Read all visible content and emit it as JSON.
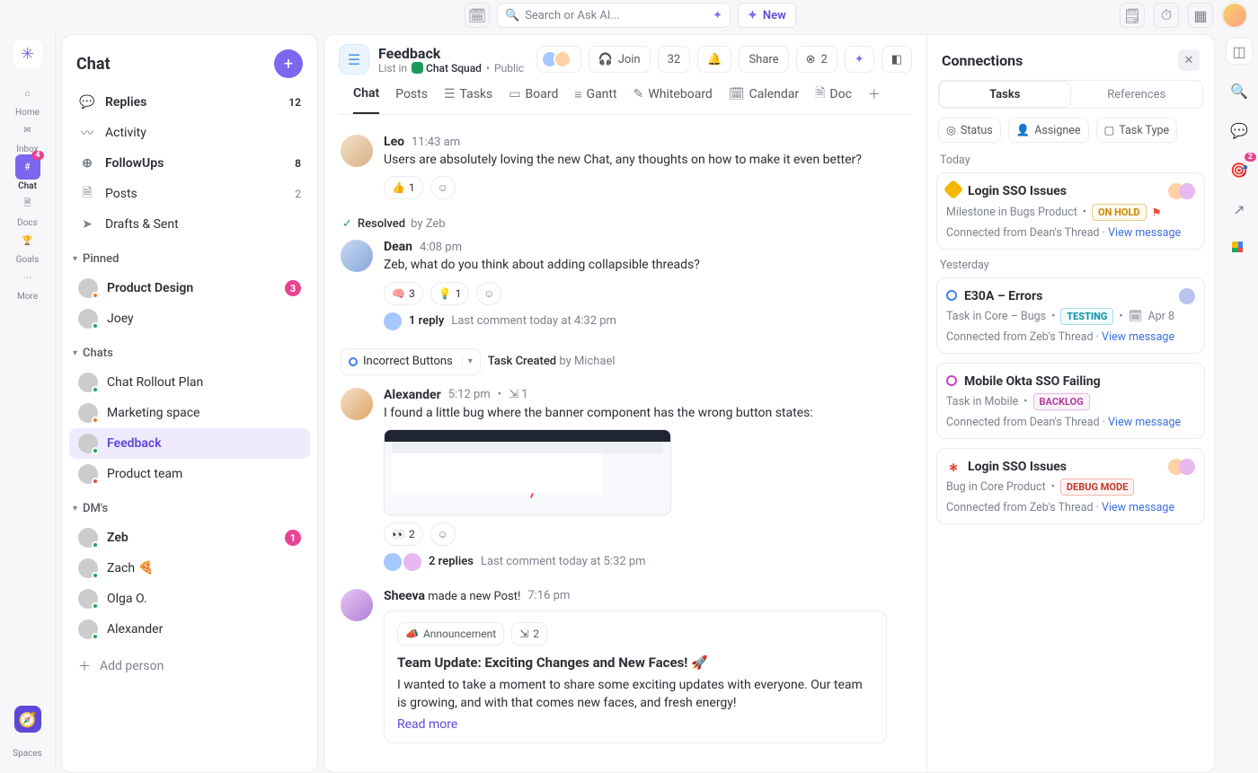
{
  "topbar": {
    "search_placeholder": "Search or Ask AI...",
    "new_label": "New"
  },
  "rail": {
    "items": [
      {
        "label": "Home",
        "glyph": "⌂"
      },
      {
        "label": "Inbox",
        "glyph": "✉"
      },
      {
        "label": "Chat",
        "glyph": "#",
        "badge": "4",
        "active": true
      },
      {
        "label": "Docs",
        "glyph": "🗎"
      },
      {
        "label": "Goals",
        "glyph": "🏆"
      },
      {
        "label": "More",
        "glyph": "⋯"
      }
    ],
    "spaces_label": "Spaces"
  },
  "chat_sidebar": {
    "title": "Chat",
    "top_rows": [
      {
        "icon": "💬",
        "label": "Replies",
        "badge": "12",
        "bold": true
      },
      {
        "icon": "〰",
        "label": "Activity"
      },
      {
        "icon": "⊕",
        "label": "FollowUps",
        "badge": "8",
        "bold": true
      },
      {
        "icon": "🗎",
        "label": "Posts",
        "badge": "2"
      },
      {
        "icon": "➤",
        "label": "Drafts & Sent"
      }
    ],
    "groups": [
      {
        "title": "Pinned",
        "items": [
          {
            "label": "Product Design",
            "badge": "3",
            "bold": true,
            "avatar": "av-g1",
            "dot": "dot-or"
          },
          {
            "label": "Joey",
            "avatar": "av-g3",
            "dot": "dot-gr"
          }
        ]
      },
      {
        "title": "Chats",
        "items": [
          {
            "label": "Chat Rollout Plan",
            "avatar": "av-g2",
            "dot": "dot-gr"
          },
          {
            "label": "Marketing space",
            "avatar": "av-g4",
            "dot": "dot-or"
          },
          {
            "label": "Feedback",
            "active": true,
            "avatar": "av-g1",
            "dot": "dot-gr"
          },
          {
            "label": "Product team",
            "avatar": "av-g5",
            "dot": "dot-rd"
          }
        ]
      },
      {
        "title": "DM's",
        "items": [
          {
            "label": "Zeb",
            "badge": "1",
            "bold": true,
            "avatar": "av-g2",
            "dot": "dot-gr"
          },
          {
            "label": "Zach 🍕",
            "avatar": "av-g6",
            "dot": "dot-gr"
          },
          {
            "label": "Olga O.",
            "avatar": "av-g4",
            "dot": "dot-gr"
          },
          {
            "label": "Alexander",
            "avatar": "av-g5",
            "dot": "dot-gr"
          }
        ]
      }
    ],
    "add_person": "Add person"
  },
  "channel": {
    "title": "Feedback",
    "sub_list": "List in",
    "squad": "Chat Squad",
    "visibility": "Public",
    "actions": {
      "join": "Join",
      "count": "32",
      "share": "Share",
      "people": "2"
    },
    "tabs": [
      "Chat",
      "Posts",
      "Tasks",
      "Board",
      "Gantt",
      "Whiteboard",
      "Calendar",
      "Doc"
    ],
    "active_tab": "Chat"
  },
  "messages": [
    {
      "kind": "msg",
      "name": "Leo",
      "time": "11:43 am",
      "avatar": "av-leo",
      "text": "Users are absolutely loving the new Chat, any thoughts on how to make it even better?",
      "reactions": [
        {
          "emoji": "👍",
          "count": "1"
        }
      ]
    },
    {
      "kind": "resolved",
      "label": "Resolved",
      "by": "by Zeb"
    },
    {
      "kind": "msg",
      "name": "Dean",
      "time": "4:08 pm",
      "avatar": "av-dean",
      "text": "Zeb, what do you think about adding collapsible threads?",
      "reactions": [
        {
          "emoji": "🧠",
          "count": "3"
        },
        {
          "emoji": "💡",
          "count": "1"
        }
      ],
      "thread": {
        "replies": "1 reply",
        "last": "Last comment today at 4:32 pm"
      }
    },
    {
      "kind": "task_created",
      "chip": "Incorrect Buttons",
      "label": "Task Created",
      "by": "by Michael"
    },
    {
      "kind": "msg",
      "name": "Alexander",
      "time": "5:12 pm",
      "avatar": "av-alex",
      "pinmeta": "1",
      "text": "I found a little bug where the banner component has the wrong button states:",
      "has_image": true,
      "reactions": [
        {
          "emoji": "👀",
          "count": "2"
        }
      ],
      "thread": {
        "replies": "2 replies",
        "last": "Last comment today at 5:32 pm",
        "two_avatars": true
      }
    },
    {
      "kind": "post",
      "name": "Sheeva",
      "verb": "made a new Post!",
      "time": "7:16 pm",
      "avatar": "av-shee",
      "post": {
        "tag1": "Announcement",
        "tag2": "2",
        "title": "Team Update: Exciting Changes and New Faces! 🚀",
        "body": "I wanted to take a moment to share some exciting updates with everyone. Our team is growing, and with that comes new faces, and fresh energy!",
        "read_more": "Read more"
      }
    }
  ],
  "connections": {
    "title": "Connections",
    "tabs": [
      "Tasks",
      "References"
    ],
    "filters": [
      "Status",
      "Assignee",
      "Task Type"
    ],
    "sections": [
      {
        "label": "Today",
        "cards": [
          {
            "icon": "diamond",
            "title": "Login SSO Issues",
            "sub": "Milestone in Bugs Product",
            "status": "ON HOLD",
            "status_cls": "st-hold",
            "flag": true,
            "from": "Connected from Dean's Thread",
            "two_av": true
          }
        ]
      },
      {
        "label": "Yesterday",
        "cards": [
          {
            "icon": "ring",
            "title": "E30A – Errors",
            "sub": "Task in Core – Bugs",
            "status": "TESTING",
            "status_cls": "st-test",
            "date": "Apr 8",
            "one_av": true,
            "from": "Connected from Zeb's Thread"
          },
          {
            "icon": "ringp",
            "title": "Mobile Okta SSO Failing",
            "sub": "Task in Mobile",
            "status": "BACKLOG",
            "status_cls": "st-back",
            "from": "Connected from Dean's Thread"
          },
          {
            "icon": "bug",
            "title": "Login SSO Issues",
            "sub": "Bug in Core Product",
            "status": "DEBUG MODE",
            "status_cls": "st-debug",
            "two_av": true,
            "from": "Connected from Zeb's Thread"
          }
        ]
      }
    ],
    "view_message": "View message"
  }
}
